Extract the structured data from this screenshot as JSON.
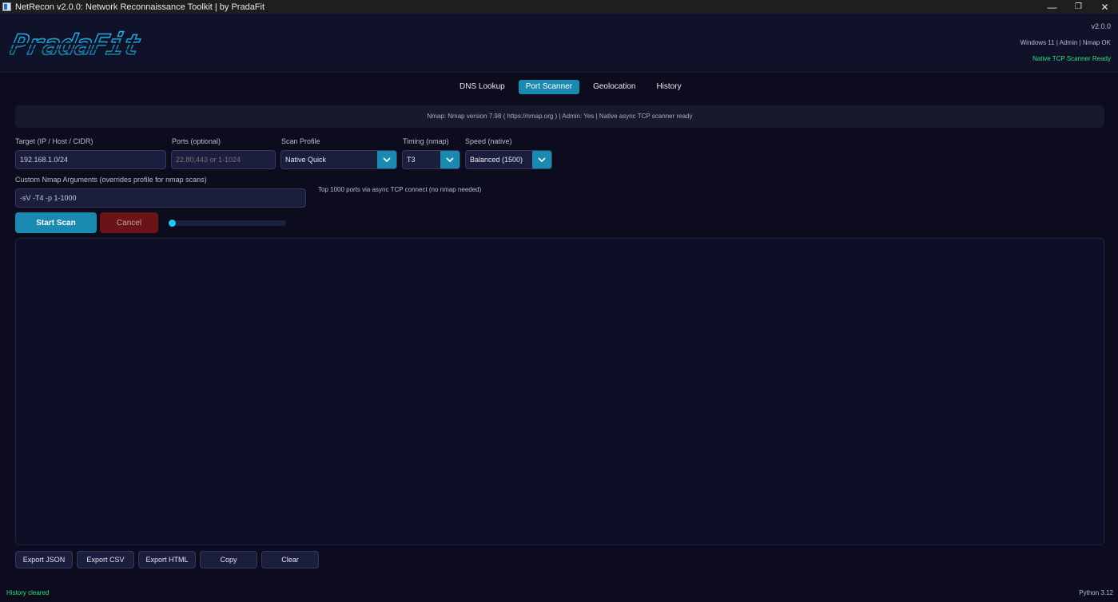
{
  "window": {
    "title": "NetRecon v2.0.0: Network Reconnaissance Toolkit  |  by PradaFit",
    "minimize": "—",
    "restore": "❐",
    "close": "✕"
  },
  "header": {
    "logo_text": "PradaFit",
    "version": "v2.0.0",
    "system_info": "Windows 11 | Admin | Nmap OK",
    "native_status": "Native TCP Scanner Ready"
  },
  "tabs": [
    {
      "label": "DNS Lookup",
      "active": false
    },
    {
      "label": "Port Scanner",
      "active": true
    },
    {
      "label": "Geolocation",
      "active": false
    },
    {
      "label": "History",
      "active": false
    }
  ],
  "status": {
    "text": "Nmap: Nmap version 7.98 ( https://nmap.org )  |  Admin: Yes  |  Native async TCP scanner ready"
  },
  "form": {
    "target_label": "Target (IP / Host / CIDR)",
    "target_value": "192.168.1.0/24",
    "ports_label": "Ports (optional)",
    "ports_placeholder": "22,80,443 or 1-1024",
    "profile_label": "Scan Profile",
    "profile_value": "Native Quick",
    "timing_label": "Timing (nmap)",
    "timing_value": "T3",
    "speed_label": "Speed (native)",
    "speed_value": "Balanced (1500)",
    "custom_label": "Custom Nmap Arguments (overrides profile for nmap scans)",
    "custom_value": "-sV -T4 -p 1-1000",
    "profile_hint": "Top 1000 ports via async TCP connect (no nmap needed)"
  },
  "actions": {
    "start_label": "Start Scan",
    "cancel_label": "Cancel",
    "progress": 0
  },
  "export": {
    "json_label": "Export JSON",
    "csv_label": "Export CSV",
    "html_label": "Export HTML",
    "copy_label": "Copy",
    "clear_label": "Clear"
  },
  "footer": {
    "message": "History cleared",
    "python_version": "Python 3.12"
  },
  "colors": {
    "accent": "#1b8ab0",
    "success": "#33e07a",
    "danger": "#6a1418",
    "background": "#0c0c1e"
  },
  "icons": {
    "dropdown": "chevron-down-icon",
    "app": "app-window-icon",
    "logo": "pradafit-logo"
  }
}
